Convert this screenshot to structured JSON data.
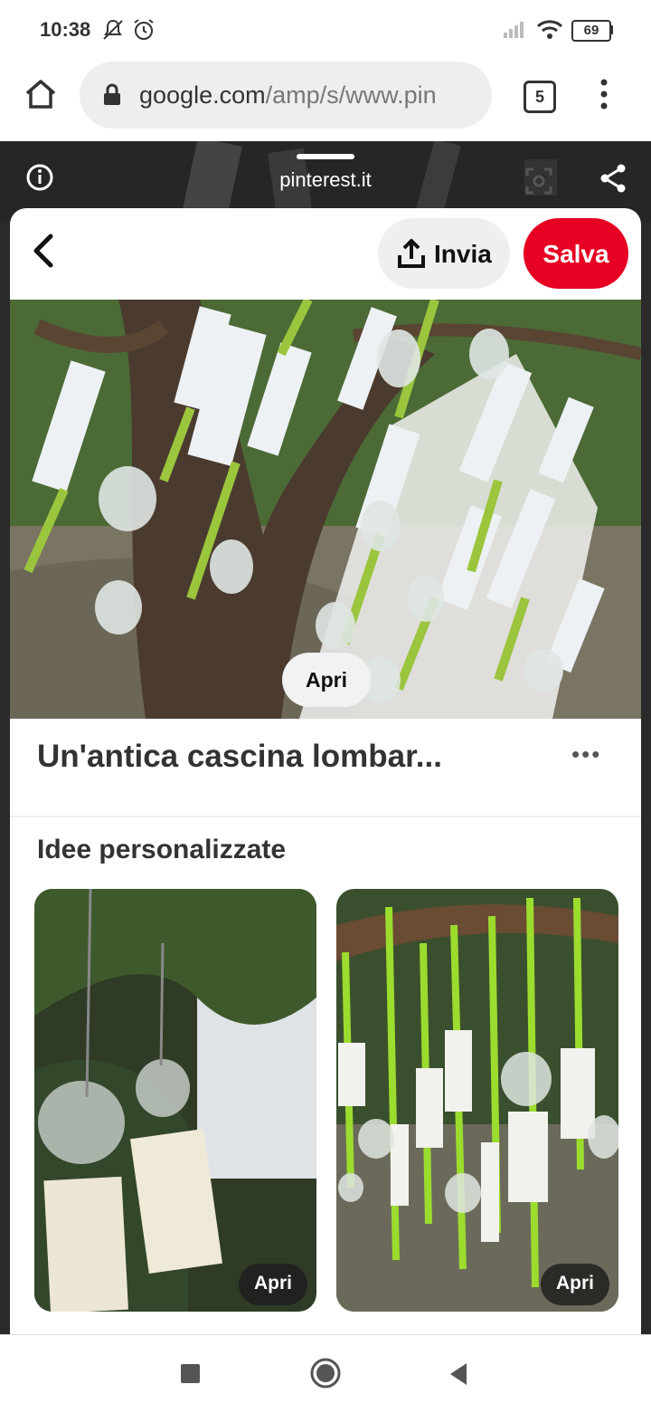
{
  "status_bar": {
    "time": "10:38",
    "icons": [
      "mute-icon",
      "alarm-icon",
      "signal-icon",
      "wifi-icon",
      "battery-icon"
    ],
    "battery": "69"
  },
  "browser": {
    "url_host": "google.com",
    "url_path": "/amp/s/www.pin",
    "tab_count": "5"
  },
  "sheet": {
    "domain": "pinterest.it",
    "invia_label": "Invia",
    "salva_label": "Salva",
    "apri_label": "Apri",
    "pin_title": "Un'antica cascina lombar...",
    "more_label": "•••"
  },
  "related": {
    "section_title": "Idee personalizzate",
    "items": [
      {
        "apri_label": "Apri"
      },
      {
        "apri_label": "Apri"
      }
    ]
  },
  "colors": {
    "salva": "#e60023",
    "ribbon": "#9bc53d",
    "foliage": "#3f5a2a"
  }
}
